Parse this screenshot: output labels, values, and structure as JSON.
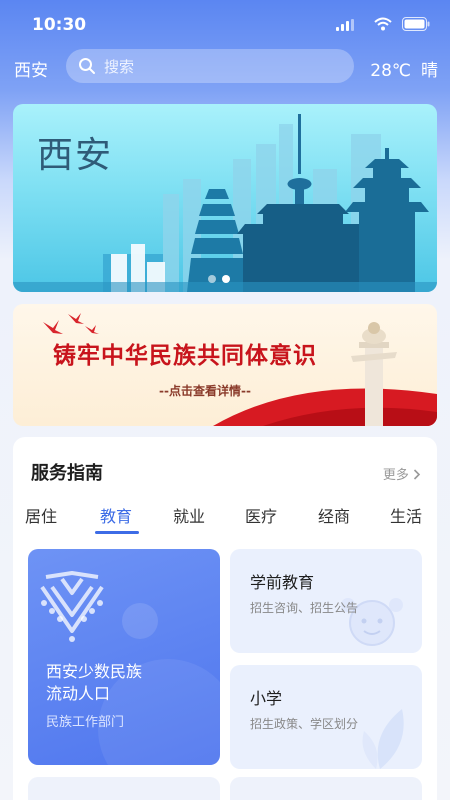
{
  "status_bar": {
    "time": "10:30"
  },
  "header": {
    "city": "西安",
    "search_placeholder": "搜索",
    "temperature": "28℃",
    "weather": "晴"
  },
  "banner": {
    "title": "西安",
    "active_slide": 1,
    "slide_count": 2
  },
  "promo": {
    "title": "铸牢中华民族共同体意识",
    "subtitle": "--点击查看详情--"
  },
  "services": {
    "title": "服务指南",
    "more_label": "更多",
    "tabs": [
      "居住",
      "教育",
      "就业",
      "医疗",
      "经商",
      "生活"
    ],
    "active_tab": "教育",
    "feature_tile": {
      "title": "西安少数民族流动人口",
      "subtitle": "民族工作部门"
    },
    "tiles": [
      {
        "title": "学前教育",
        "subtitle": "招生咨询、招生公告"
      },
      {
        "title": "小学",
        "subtitle": "招生政策、学区划分"
      }
    ]
  },
  "colors": {
    "accent": "#3d6ce6",
    "header_blue": "#5b86f2",
    "promo_red": "#c8141c"
  },
  "icons": [
    "signal-icon",
    "wifi-icon",
    "battery-icon",
    "search-icon",
    "chevron-right-icon",
    "ethnic-emblem-icon",
    "child-face-icon",
    "leaf-icon"
  ]
}
